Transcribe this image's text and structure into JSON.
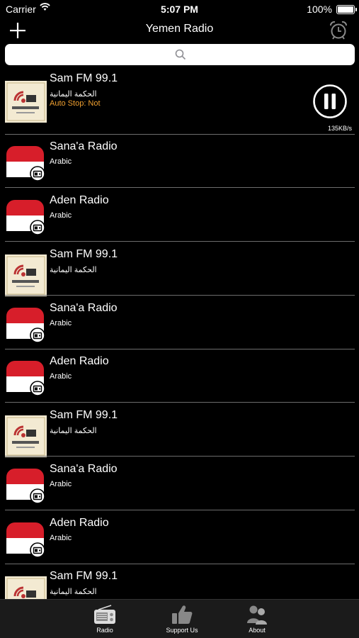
{
  "status_bar": {
    "carrier": "Carrier",
    "time": "5:07 PM",
    "battery": "100%"
  },
  "nav": {
    "title": "Yemen Radio",
    "add_icon": "plus-icon",
    "alarm_icon": "alarm-clock-icon"
  },
  "search": {
    "placeholder": ""
  },
  "stations": [
    {
      "name": "Sam FM 99.1",
      "subtitle": "الحكمة اليمانية",
      "type": "logo",
      "auto_stop": "Auto Stop: Not",
      "playing": true,
      "speed": "135KB/s"
    },
    {
      "name": "Sana'a Radio",
      "subtitle": "Arabic",
      "type": "flag"
    },
    {
      "name": "Aden Radio",
      "subtitle": "Arabic",
      "type": "flag"
    },
    {
      "name": "Sam FM 99.1",
      "subtitle": "الحكمة اليمانية",
      "type": "logo"
    },
    {
      "name": "Sana'a Radio",
      "subtitle": "Arabic",
      "type": "flag"
    },
    {
      "name": "Aden Radio",
      "subtitle": "Arabic",
      "type": "flag"
    },
    {
      "name": "Sam FM 99.1",
      "subtitle": "الحكمة اليمانية",
      "type": "logo"
    },
    {
      "name": "Sana'a Radio",
      "subtitle": "Arabic",
      "type": "flag"
    },
    {
      "name": "Aden Radio",
      "subtitle": "Arabic",
      "type": "flag"
    },
    {
      "name": "Sam FM 99.1",
      "subtitle": "الحكمة اليمانية",
      "type": "logo"
    }
  ],
  "tabs": [
    {
      "label": "Radio",
      "icon": "radio-icon"
    },
    {
      "label": "Support Us",
      "icon": "thumbs-up-icon"
    },
    {
      "label": "About",
      "icon": "people-icon"
    }
  ]
}
